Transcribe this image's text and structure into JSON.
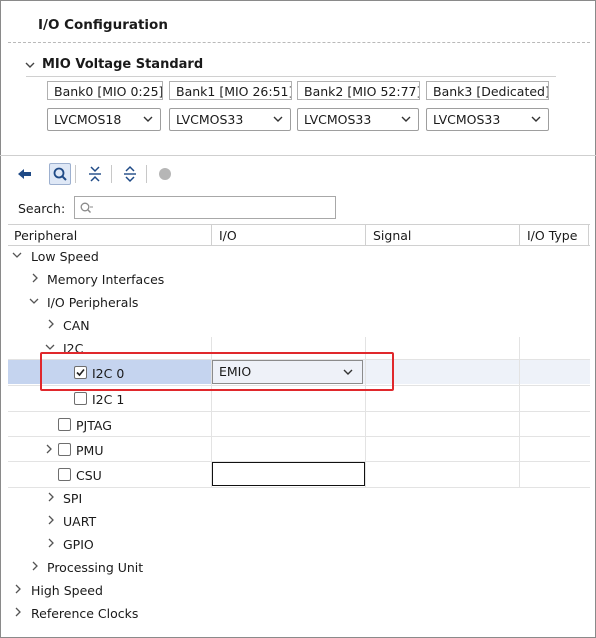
{
  "page": {
    "title": "I/O Configuration"
  },
  "mio_voltage": {
    "title": "MIO Voltage Standard",
    "banks": [
      {
        "label": "Bank0 [MIO 0:25]",
        "value": "LVCMOS18"
      },
      {
        "label": "Bank1 [MIO 26:51]",
        "value": "LVCMOS33"
      },
      {
        "label": "Bank2 [MIO 52:77]",
        "value": "LVCMOS33"
      },
      {
        "label": "Bank3 [Dedicated]",
        "value": "LVCMOS33"
      }
    ]
  },
  "toolbar": {
    "icons": [
      "back-arrow-icon",
      "search-icon",
      "collapse-all-icon",
      "expand-all-icon",
      "circle-icon"
    ]
  },
  "search": {
    "label": "Search:",
    "placeholder": "Q-",
    "value": ""
  },
  "table": {
    "headers": [
      "Peripheral",
      "I/O",
      "Signal",
      "I/O Type"
    ],
    "rows": [
      {
        "label": "Low Speed",
        "expanded": true
      },
      {
        "label": "Memory Interfaces",
        "expanded": false
      },
      {
        "label": "I/O Peripherals",
        "expanded": true
      },
      {
        "label": "CAN",
        "expanded": false
      },
      {
        "label": "I2C",
        "expanded": true
      },
      {
        "label": "I2C 0",
        "checked": true,
        "io": "EMIO",
        "selected": true
      },
      {
        "label": "I2C 1",
        "checked": false
      },
      {
        "label": "PJTAG",
        "checked": false
      },
      {
        "label": "PMU",
        "checked": false,
        "expanded": false
      },
      {
        "label": "CSU",
        "checked": false
      },
      {
        "label": "SPI",
        "expanded": false
      },
      {
        "label": "UART",
        "expanded": false
      },
      {
        "label": "GPIO",
        "expanded": false
      },
      {
        "label": "Processing Unit",
        "expanded": false
      },
      {
        "label": "High Speed",
        "expanded": false
      },
      {
        "label": "Reference Clocks",
        "expanded": false
      }
    ]
  },
  "colors": {
    "highlight": "#e0282c",
    "selection": "#c5d4ef",
    "accent": "#1f4a86"
  }
}
